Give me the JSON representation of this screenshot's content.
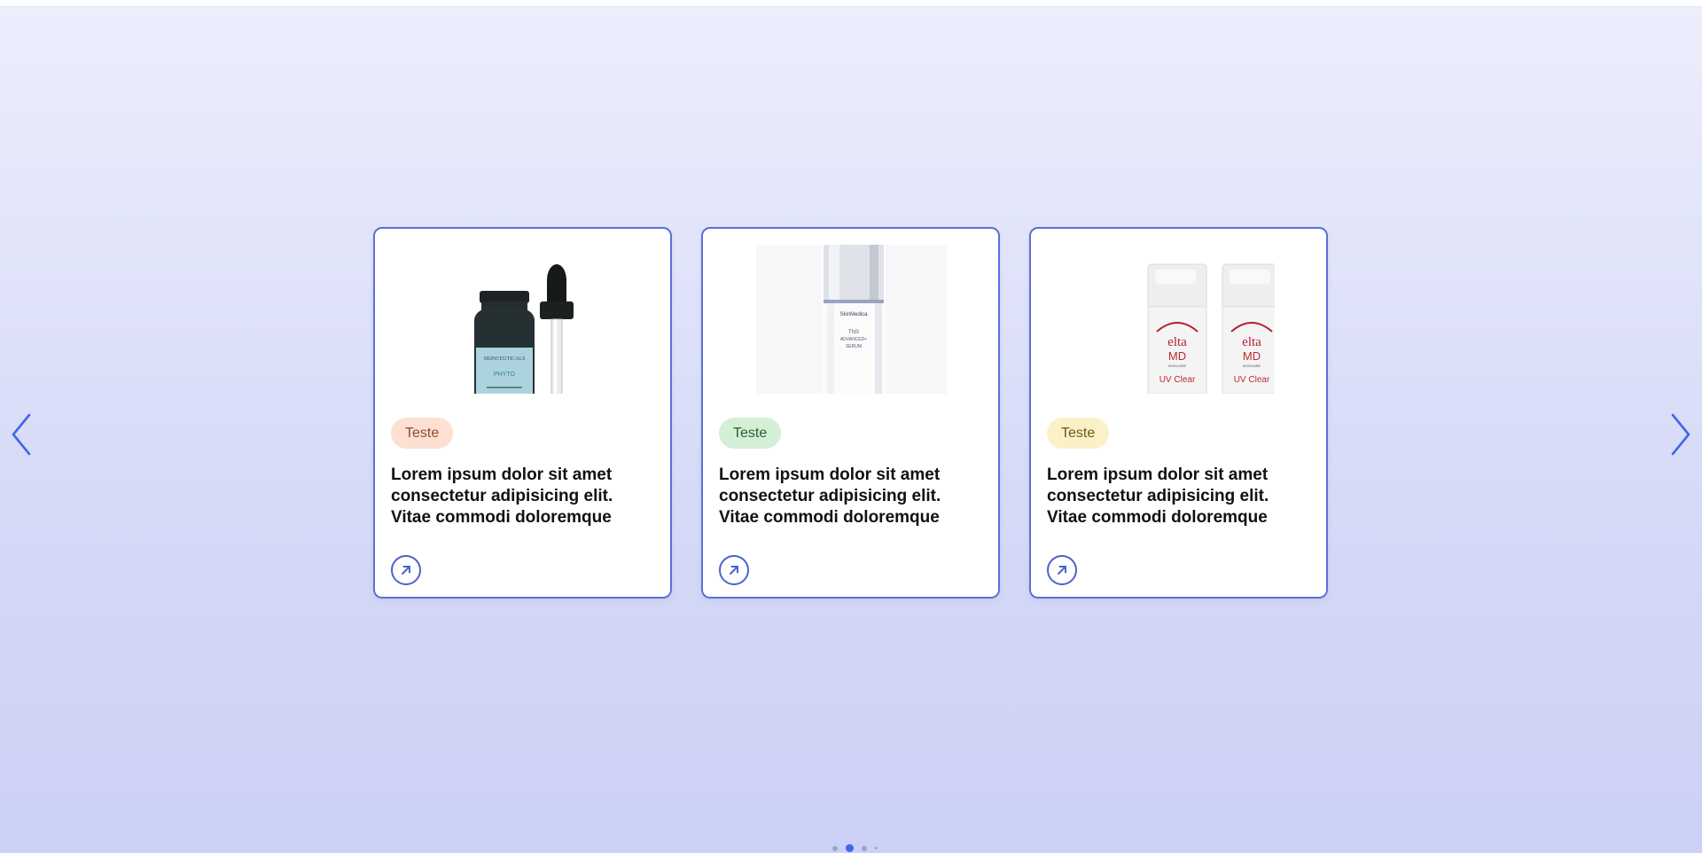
{
  "carousel": {
    "prev_icon": "chevron-left-icon",
    "next_icon": "chevron-right-icon",
    "accent_color": "#3f66e8",
    "card_border_color": "#5b71d8",
    "cards": [
      {
        "image": "serum-dropper-bottle",
        "image_text": [
          "SKINCEUTICALS",
          "PHYTO"
        ],
        "tag": "Teste",
        "tag_color": "#fde0d2",
        "text": "Lorem ipsum dolor sit amet consectetur adipisicing elit. Vitae commodi doloremque",
        "link_icon": "arrow-up-right-icon"
      },
      {
        "image": "serum-pump-bottle",
        "image_text": [
          "SkinMedica",
          "TNS",
          "ADVANCED+",
          "SERUM"
        ],
        "tag": "Teste",
        "tag_color": "#d3f0d6",
        "text": "Lorem ipsum dolor sit amet consectetur adipisicing elit. Vitae commodi doloremque",
        "link_icon": "arrow-up-right-icon"
      },
      {
        "image": "sunscreen-pump-bottles",
        "image_text": [
          "elta",
          "MD",
          "SKINCARE",
          "UV Clear"
        ],
        "tag": "Teste",
        "tag_color": "#fbf1c7",
        "text": "Lorem ipsum dolor sit amet consectetur adipisicing elit. Vitae commodi doloremque",
        "link_icon": "arrow-up-right-icon"
      }
    ],
    "pagination": {
      "total": 4,
      "active_index": 1
    }
  }
}
